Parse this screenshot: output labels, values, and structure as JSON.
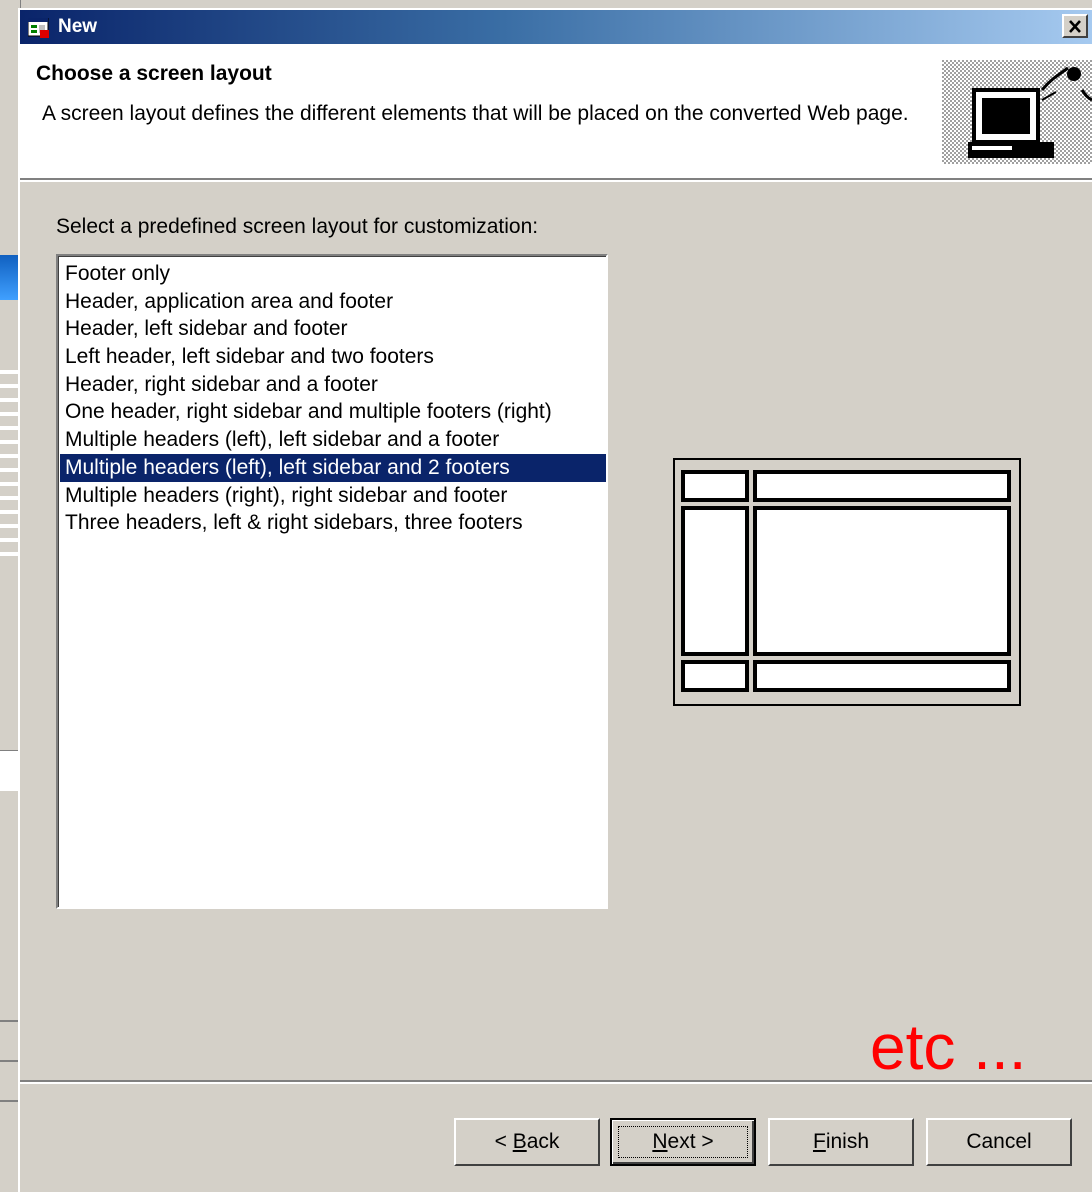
{
  "dialog": {
    "title": "New",
    "banner_title": "Choose a screen layout",
    "banner_description": "A screen layout defines the different elements that will be placed on the converted Web page.",
    "prompt": "Select a predefined screen layout for customization:",
    "layouts": [
      "Footer only",
      "Header, application area and footer",
      "Header, left sidebar and footer",
      "Left header, left sidebar and two footers",
      "Header, right sidebar and a footer",
      "One header, right sidebar and multiple footers (right)",
      "Multiple headers (left), left sidebar and a footer",
      "Multiple headers (left), left sidebar and 2 footers",
      "Multiple headers (right), right sidebar and footer",
      "Three headers, left & right sidebars, three footers"
    ],
    "selected_index": 7,
    "annotation": "etc ...",
    "buttons": {
      "back_prefix": "< ",
      "back_mnemonic": "B",
      "back_rest": "ack",
      "next_mnemonic": "N",
      "next_rest": "ext >",
      "finish_mnemonic": "F",
      "finish_rest": "inish",
      "cancel": "Cancel"
    }
  },
  "colors": {
    "title_gradient_start": "#0a246a",
    "title_gradient_end": "#a6caf0",
    "selection": "#0a246a",
    "annotation": "#ff0000",
    "face": "#d4d0c8"
  },
  "icons": [
    "app-icon",
    "close-icon",
    "computer-wizard-icon"
  ]
}
